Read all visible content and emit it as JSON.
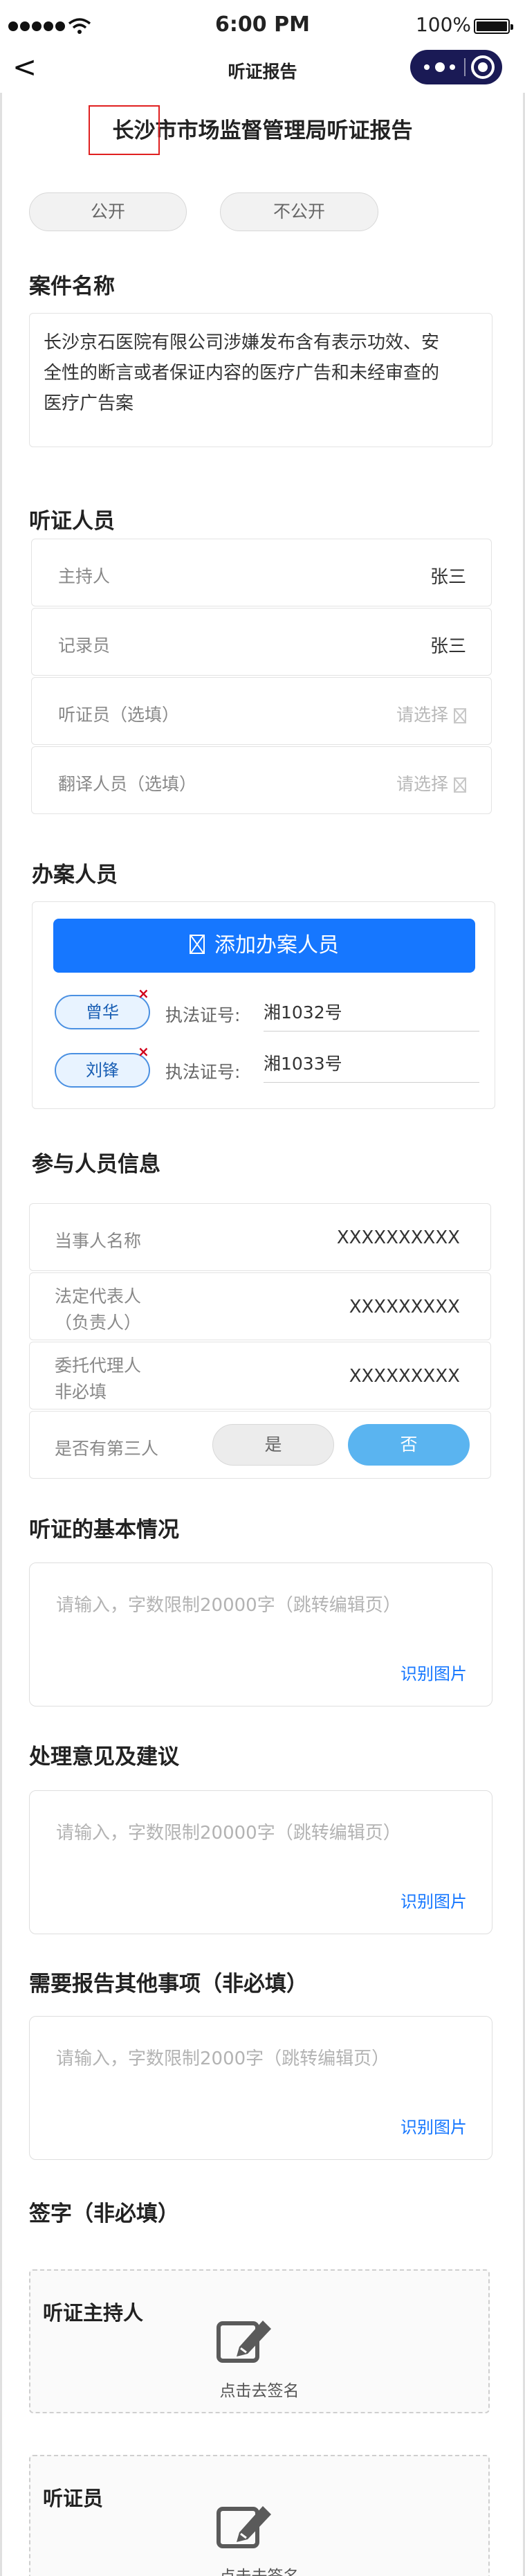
{
  "status_bar": {
    "time": "6:00 PM",
    "battery": "100%"
  },
  "nav": {
    "back": "<",
    "title": "听证报告"
  },
  "document": {
    "title": "长沙市市场监督管理局听证报告"
  },
  "visibility": {
    "public": "公开",
    "private": "不公开"
  },
  "case": {
    "title": "案件名称",
    "lines": [
      "长沙京石医院有限公司涉嫌发布含有表示功效、安",
      "全性的断言或者保证内容的医疗广告和未经审查的",
      "医疗广告案"
    ]
  },
  "hearing_staff": {
    "title": "听证人员",
    "rows": [
      {
        "label": "主持人",
        "value": "张三"
      },
      {
        "label": "记录员",
        "value": "张三"
      },
      {
        "label": "听证员（选填）",
        "hint": "请选择"
      },
      {
        "label": "翻译人员（选填）",
        "hint": "请选择"
      }
    ]
  },
  "handlers": {
    "title": "办案人员",
    "add_button": "添加办案人员",
    "cert_label": "执法证号:",
    "people": [
      {
        "name": "曾华",
        "cert": "湘1032号",
        "remove": "×"
      },
      {
        "name": "刘锋",
        "cert": "湘1033号",
        "remove": "×"
      }
    ]
  },
  "participants": {
    "title": "参与人员信息",
    "rows": [
      {
        "label": "当事人名称",
        "value": "XXXXXXXXXX"
      },
      {
        "label_lines": [
          "法定代表人",
          "（负责人）"
        ],
        "value": "XXXXXXXXX"
      },
      {
        "label_lines": [
          "委托代理人",
          "非必填"
        ],
        "value": "XXXXXXXXX"
      }
    ],
    "third_party": {
      "label": "是否有第三人",
      "yes": "是",
      "no": "否",
      "selected": "否"
    }
  },
  "basic_situation": {
    "title": "听证的基本情况",
    "placeholder": "请输入，字数限制20000字（跳转编辑页）",
    "action": "识别图片"
  },
  "opinions": {
    "title": "处理意见及建议",
    "placeholder": "请输入，字数限制20000字（跳转编辑页）",
    "action": "识别图片"
  },
  "other_matters": {
    "title": "需要报告其他事项（非必填）",
    "placeholder": "请输入，字数限制2000字（跳转编辑页）",
    "action": "识别图片"
  },
  "signatures": {
    "title": "签字（非必填）",
    "items": [
      {
        "role": "听证主持人",
        "action": "点击去签名"
      },
      {
        "role": "听证员",
        "action": "点击去签名"
      }
    ]
  },
  "colors": {
    "primary": "#1677ff",
    "accent_red": "#e02020",
    "capsule": "#1a1a55",
    "toggle_selected": "#5ab4f0"
  }
}
